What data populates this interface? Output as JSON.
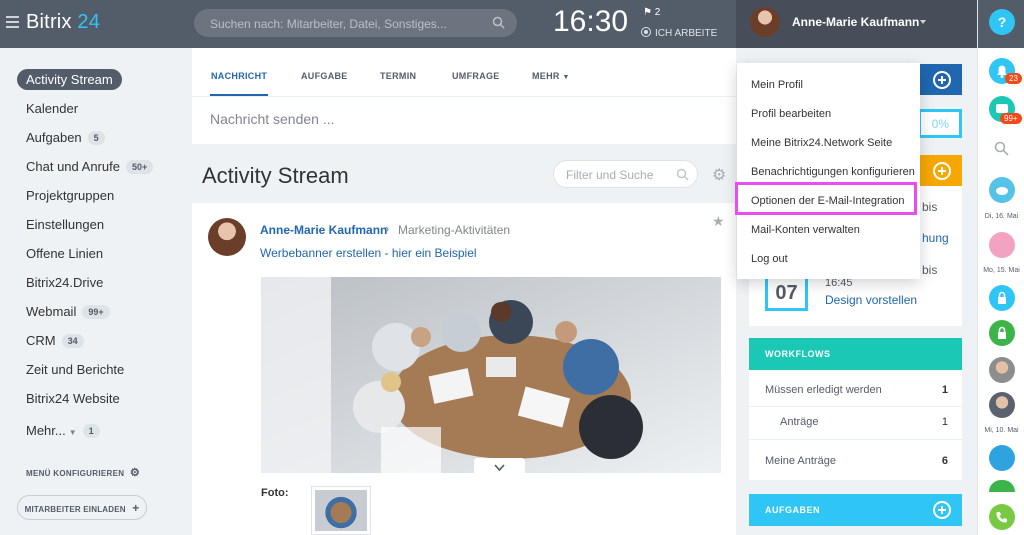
{
  "header": {
    "logo_text": "Bitrix",
    "logo_num": "24",
    "search_placeholder": "Suchen nach: Mitarbeiter, Datei, Sonstiges...",
    "time": "16:30",
    "flag_count": "2",
    "work_status": "ICH ARBEITE",
    "user_name": "Anne-Marie Kaufmann"
  },
  "sidebar": {
    "items": [
      {
        "label": "Activity Stream"
      },
      {
        "label": "Kalender"
      },
      {
        "label": "Aufgaben",
        "count": "5"
      },
      {
        "label": "Chat und Anrufe",
        "count": "50+"
      },
      {
        "label": "Projektgruppen"
      },
      {
        "label": "Einstellungen"
      },
      {
        "label": "Offene Linien"
      },
      {
        "label": "Bitrix24.Drive"
      },
      {
        "label": "Webmail",
        "count": "99+"
      },
      {
        "label": "CRM",
        "count": "34"
      },
      {
        "label": "Zeit und Berichte"
      },
      {
        "label": "Bitrix24 Website"
      },
      {
        "label": "Mehr...",
        "count": "1"
      }
    ],
    "menu_config": "MENÜ KONFIGURIEREN",
    "invite": "MITARBEITER EINLADEN"
  },
  "feed": {
    "tabs": [
      "NACHRICHT",
      "AUFGABE",
      "TERMIN",
      "UMFRAGE",
      "MEHR"
    ],
    "compose_placeholder": "Nachricht senden ...",
    "title": "Activity Stream",
    "filter_placeholder": "Filter und Suche",
    "post": {
      "author": "Anne-Marie Kaufmann",
      "destination": "Marketing-Aktivitäten",
      "link": "Werbebanner erstellen - hier ein Beispiel",
      "photo_label": "Foto:"
    }
  },
  "dropdown": {
    "items": [
      "Mein Profil",
      "Profil bearbeiten",
      "Meine Bitrix24.Network Seite",
      "Benachrichtigungen konfigurieren",
      "Optionen der E-Mail-Integration",
      "Mail-Konten verwalten",
      "Log out"
    ]
  },
  "right_column": {
    "percent": "0%",
    "bis_1": "bis",
    "hung": "hung",
    "bis_2": "bis",
    "event_time": "16:45",
    "event_day": "07",
    "event_title": "Design vorstellen",
    "workflows": {
      "title": "WORKFLOWS",
      "rows": [
        {
          "label": "Müssen erledigt werden",
          "value": "1"
        },
        {
          "label": "Anträge",
          "value": "1"
        },
        {
          "label": "Meine Anträge",
          "value": "6"
        }
      ]
    },
    "tasks_title": "AUFGABEN"
  },
  "right_bar": {
    "help": "?",
    "notif_count": "23",
    "chat_count": "99+",
    "dates": [
      "Di, 16. Mai",
      "Mo, 15. Mai",
      "Mi, 10. Mai"
    ]
  },
  "colors": {
    "topbar": "#535c69",
    "accent_blue": "#2067b0",
    "cyan": "#2fc6f6",
    "teal": "#1bc8b5",
    "highlight": "#e94ef0"
  }
}
